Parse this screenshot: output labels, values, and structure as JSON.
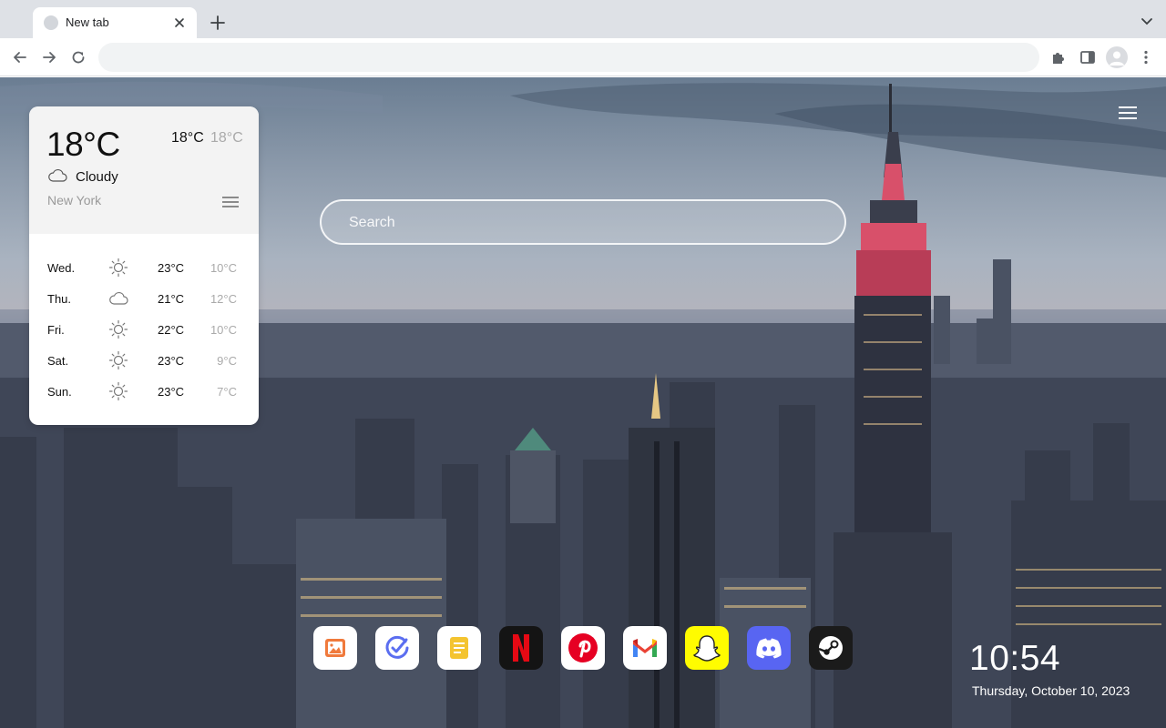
{
  "browser": {
    "tab_title": "New tab",
    "address_value": ""
  },
  "weather": {
    "current_temp": "18°C",
    "high": "18°C",
    "low": "18°C",
    "condition": "Cloudy",
    "condition_icon": "cloud-icon",
    "city": "New York",
    "forecast": [
      {
        "day": "Wed.",
        "icon": "sun-icon",
        "high": "23°C",
        "low": "10°C"
      },
      {
        "day": "Thu.",
        "icon": "cloud-icon",
        "high": "21°C",
        "low": "12°C"
      },
      {
        "day": "Fri.",
        "icon": "sun-icon",
        "high": "22°C",
        "low": "10°C"
      },
      {
        "day": "Sat.",
        "icon": "sun-icon",
        "high": "23°C",
        "low": "9°C"
      },
      {
        "day": "Sun.",
        "icon": "sun-icon",
        "high": "23°C",
        "low": "7°C"
      }
    ]
  },
  "search": {
    "placeholder": "Search"
  },
  "dock": {
    "items": [
      {
        "name": "gallery-app",
        "icon": "image-icon",
        "color": "#ffffff"
      },
      {
        "name": "todo-app",
        "icon": "checkmark-icon",
        "color": "#ffffff"
      },
      {
        "name": "notes-app",
        "icon": "notes-icon",
        "color": "#ffffff"
      },
      {
        "name": "netflix",
        "icon": "netflix-icon",
        "color": "#141414"
      },
      {
        "name": "pinterest",
        "icon": "pinterest-icon",
        "color": "#ffffff"
      },
      {
        "name": "gmail",
        "icon": "gmail-icon",
        "color": "#ffffff"
      },
      {
        "name": "snapchat",
        "icon": "snapchat-icon",
        "color": "#fffc00"
      },
      {
        "name": "discord",
        "icon": "discord-icon",
        "color": "#5865f2"
      },
      {
        "name": "steam",
        "icon": "steam-icon",
        "color": "#1b1b1b"
      }
    ]
  },
  "clock": {
    "time": "10:54",
    "date": "Thursday, October 10, 2023"
  }
}
